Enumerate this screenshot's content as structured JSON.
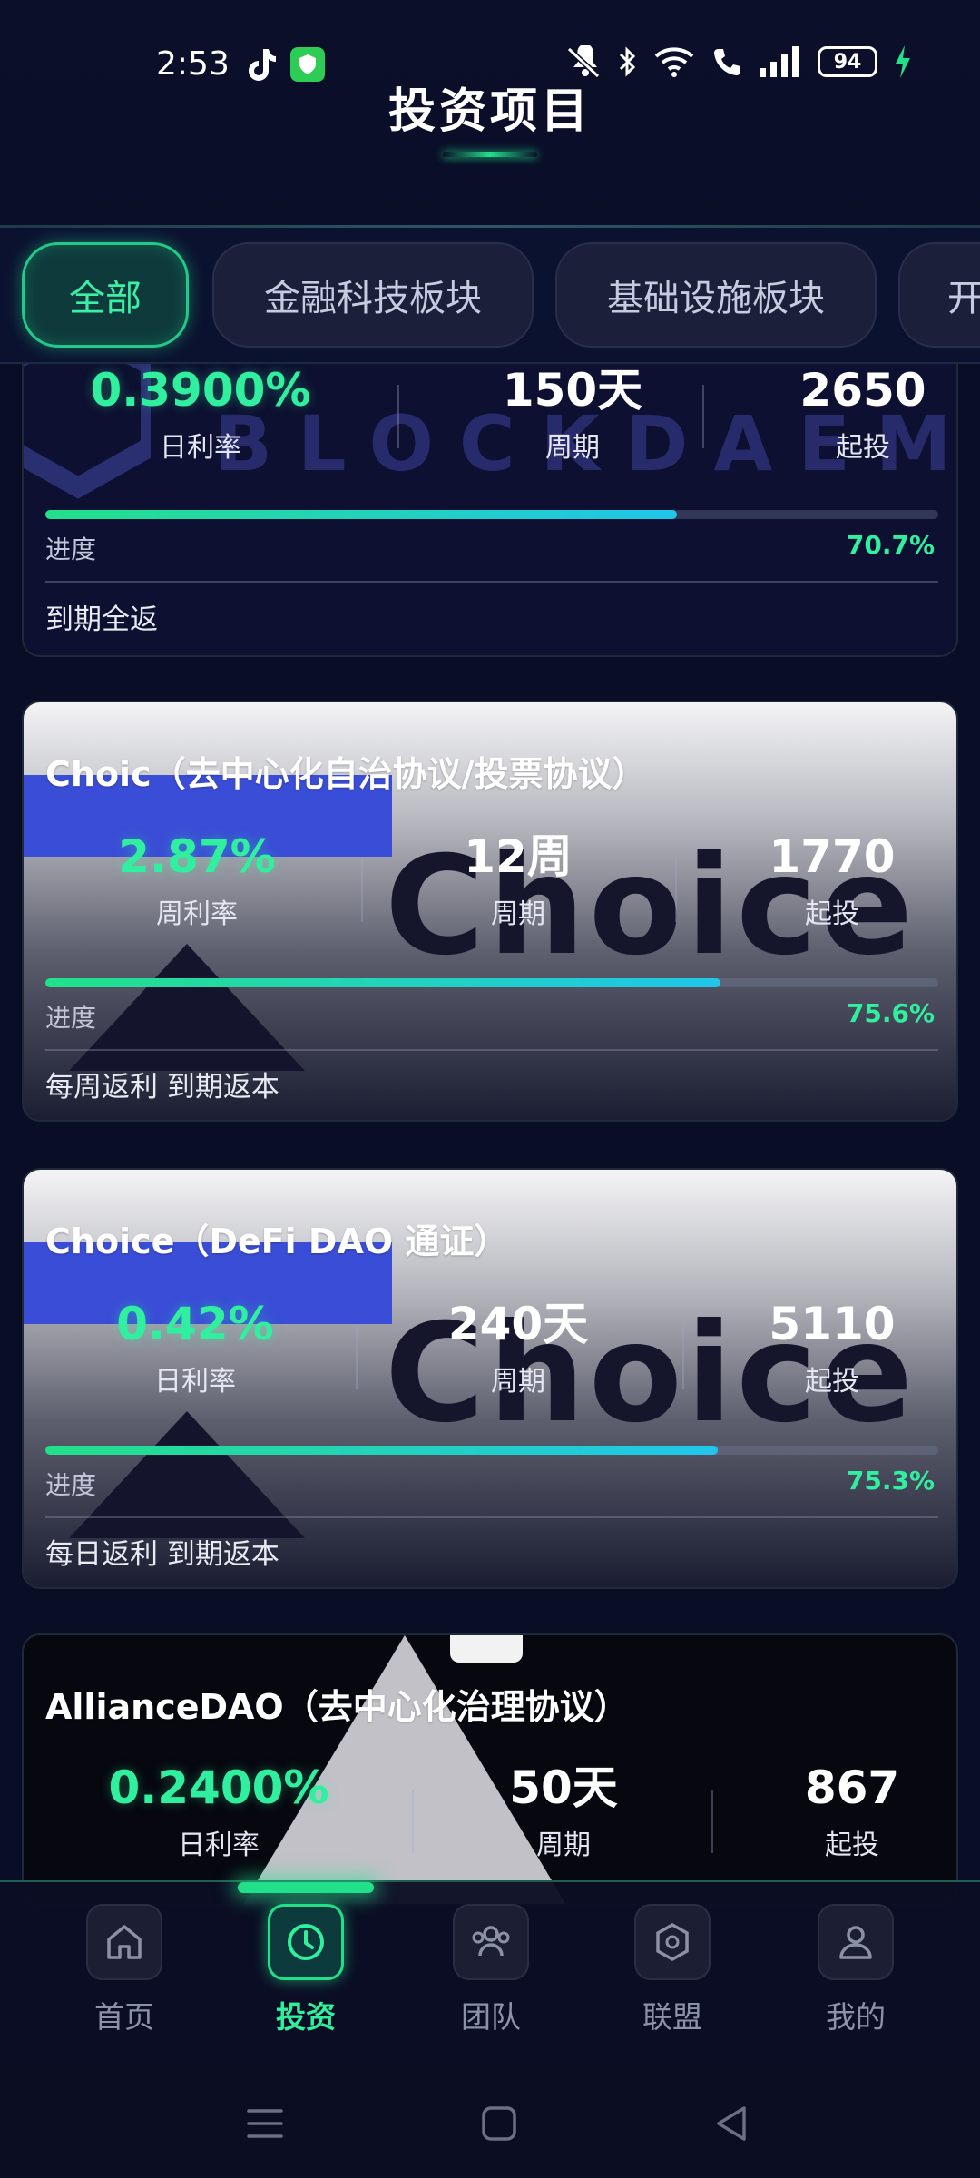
{
  "status_bar": {
    "time": "2:53",
    "battery": "94"
  },
  "header": {
    "title": "投资项目"
  },
  "tabs": [
    {
      "label": "全部",
      "active": true
    },
    {
      "label": "金融科技板块",
      "active": false
    },
    {
      "label": "基础设施板块",
      "active": false
    },
    {
      "label": "开",
      "active": false
    }
  ],
  "cards": [
    {
      "title": "",
      "watermark": "BLOCKDAEMON",
      "rate_value": "0.3900%",
      "rate_label": "日利率",
      "period_value": "150天",
      "period_label": "周期",
      "min_value": "2650",
      "min_label": "起投",
      "progress_label": "进度",
      "progress_value": "70.7%",
      "progress": 0.707,
      "return_mode": "到期全返"
    },
    {
      "title": "Choic（去中心化自治协议/投票协议）",
      "brand": "Choice",
      "rate_value": "2.87%",
      "rate_label": "周利率",
      "period_value": "12周",
      "period_label": "周期",
      "min_value": "1770",
      "min_label": "起投",
      "progress_label": "进度",
      "progress_value": "75.6%",
      "progress": 0.756,
      "return_mode": "每周返利 到期返本"
    },
    {
      "title": "Choice（DeFi DAO 通证）",
      "brand": "Choice",
      "rate_value": "0.42%",
      "rate_label": "日利率",
      "period_value": "240天",
      "period_label": "周期",
      "min_value": "5110",
      "min_label": "起投",
      "progress_label": "进度",
      "progress_value": "75.3%",
      "progress": 0.753,
      "return_mode": "每日返利 到期返本"
    },
    {
      "title": "AllianceDAO（去中心化治理协议）",
      "rate_value": "0.2400%",
      "rate_label": "日利率",
      "period_value": "50天",
      "period_label": "周期",
      "min_value": "867",
      "min_label": "起投"
    }
  ],
  "bottom_nav": [
    {
      "label": "首页",
      "icon": "home-icon",
      "active": false
    },
    {
      "label": "投资",
      "icon": "clock-icon",
      "active": true
    },
    {
      "label": "团队",
      "icon": "team-icon",
      "active": false
    },
    {
      "label": "联盟",
      "icon": "alliance-icon",
      "active": false
    },
    {
      "label": "我的",
      "icon": "profile-icon",
      "active": false
    }
  ],
  "colors": {
    "accent": "#22e08a",
    "background": "#0a0d26",
    "progress_end": "#21c6ea"
  }
}
